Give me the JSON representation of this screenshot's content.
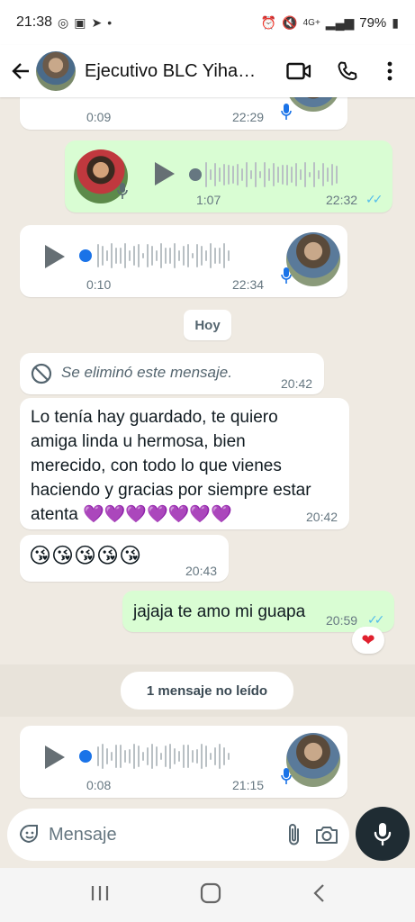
{
  "status_bar": {
    "time": "21:38",
    "battery": "79%",
    "network": "4G+"
  },
  "header": {
    "contact_name": "Ejecutivo BLC Yiha…"
  },
  "messages": {
    "voice_top": {
      "duration": "0:09",
      "time": "22:29"
    },
    "voice_out": {
      "duration": "1:07",
      "time": "22:32"
    },
    "voice_in_1": {
      "duration": "0:10",
      "time": "22:34"
    },
    "date_chip": "Hoy",
    "deleted": {
      "text": "Se eliminó este mensaje.",
      "time": "20:42"
    },
    "long_text": {
      "lines": [
        "Lo tenía hay guardado, te quiero",
        "amiga linda u hermosa, bien",
        "merecido, con todo lo que vienes",
        "haciendo y gracias por siempre estar",
        "atenta 💜💜💜💜💜💜💜"
      ],
      "time": "20:42"
    },
    "emoji_msg": {
      "text": "😘😘😘😘😘",
      "time": "20:43"
    },
    "out_text": {
      "text": "jajaja te amo mi guapa",
      "time": "20:59",
      "reaction": "❤"
    },
    "unread": "1 mensaje no leído",
    "voice_in_2": {
      "duration": "0:08",
      "time": "21:15"
    }
  },
  "composer": {
    "placeholder": "Mensaje"
  },
  "colors": {
    "chat_bg": "#efeae2",
    "outgoing_bubble": "#d9fdd3",
    "incoming_bubble": "#ffffff",
    "read_ticks": "#53bdeb",
    "voice_dot_in": "#1a73e8",
    "mic_button": "#1f2c33"
  },
  "icons": {
    "back": "arrow-back-icon",
    "video": "video-call-icon",
    "call": "phone-icon",
    "menu": "more-vert-icon",
    "sticker": "sticker-icon",
    "attach": "paperclip-icon",
    "camera": "camera-icon",
    "mic": "microphone-icon"
  }
}
